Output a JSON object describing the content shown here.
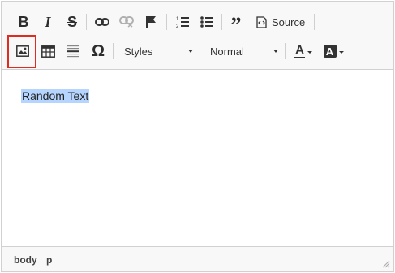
{
  "toolbar": {
    "row1": {
      "bold_label": "B",
      "italic_label": "I",
      "strike_label": "S",
      "blockquote_label": "”",
      "source_label": "Source"
    },
    "row2": {
      "special_char_label": "Ω",
      "styles_label": "Styles",
      "format_label": "Normal",
      "text_color_label": "A",
      "bg_color_label": "A"
    }
  },
  "content": {
    "selected_text": "Random Text"
  },
  "statusbar": {
    "path": [
      "body",
      "p"
    ]
  },
  "colors": {
    "highlight_border": "#e02b20",
    "selection": "#b5d5ff",
    "toolbar_bg": "#f8f8f8"
  }
}
